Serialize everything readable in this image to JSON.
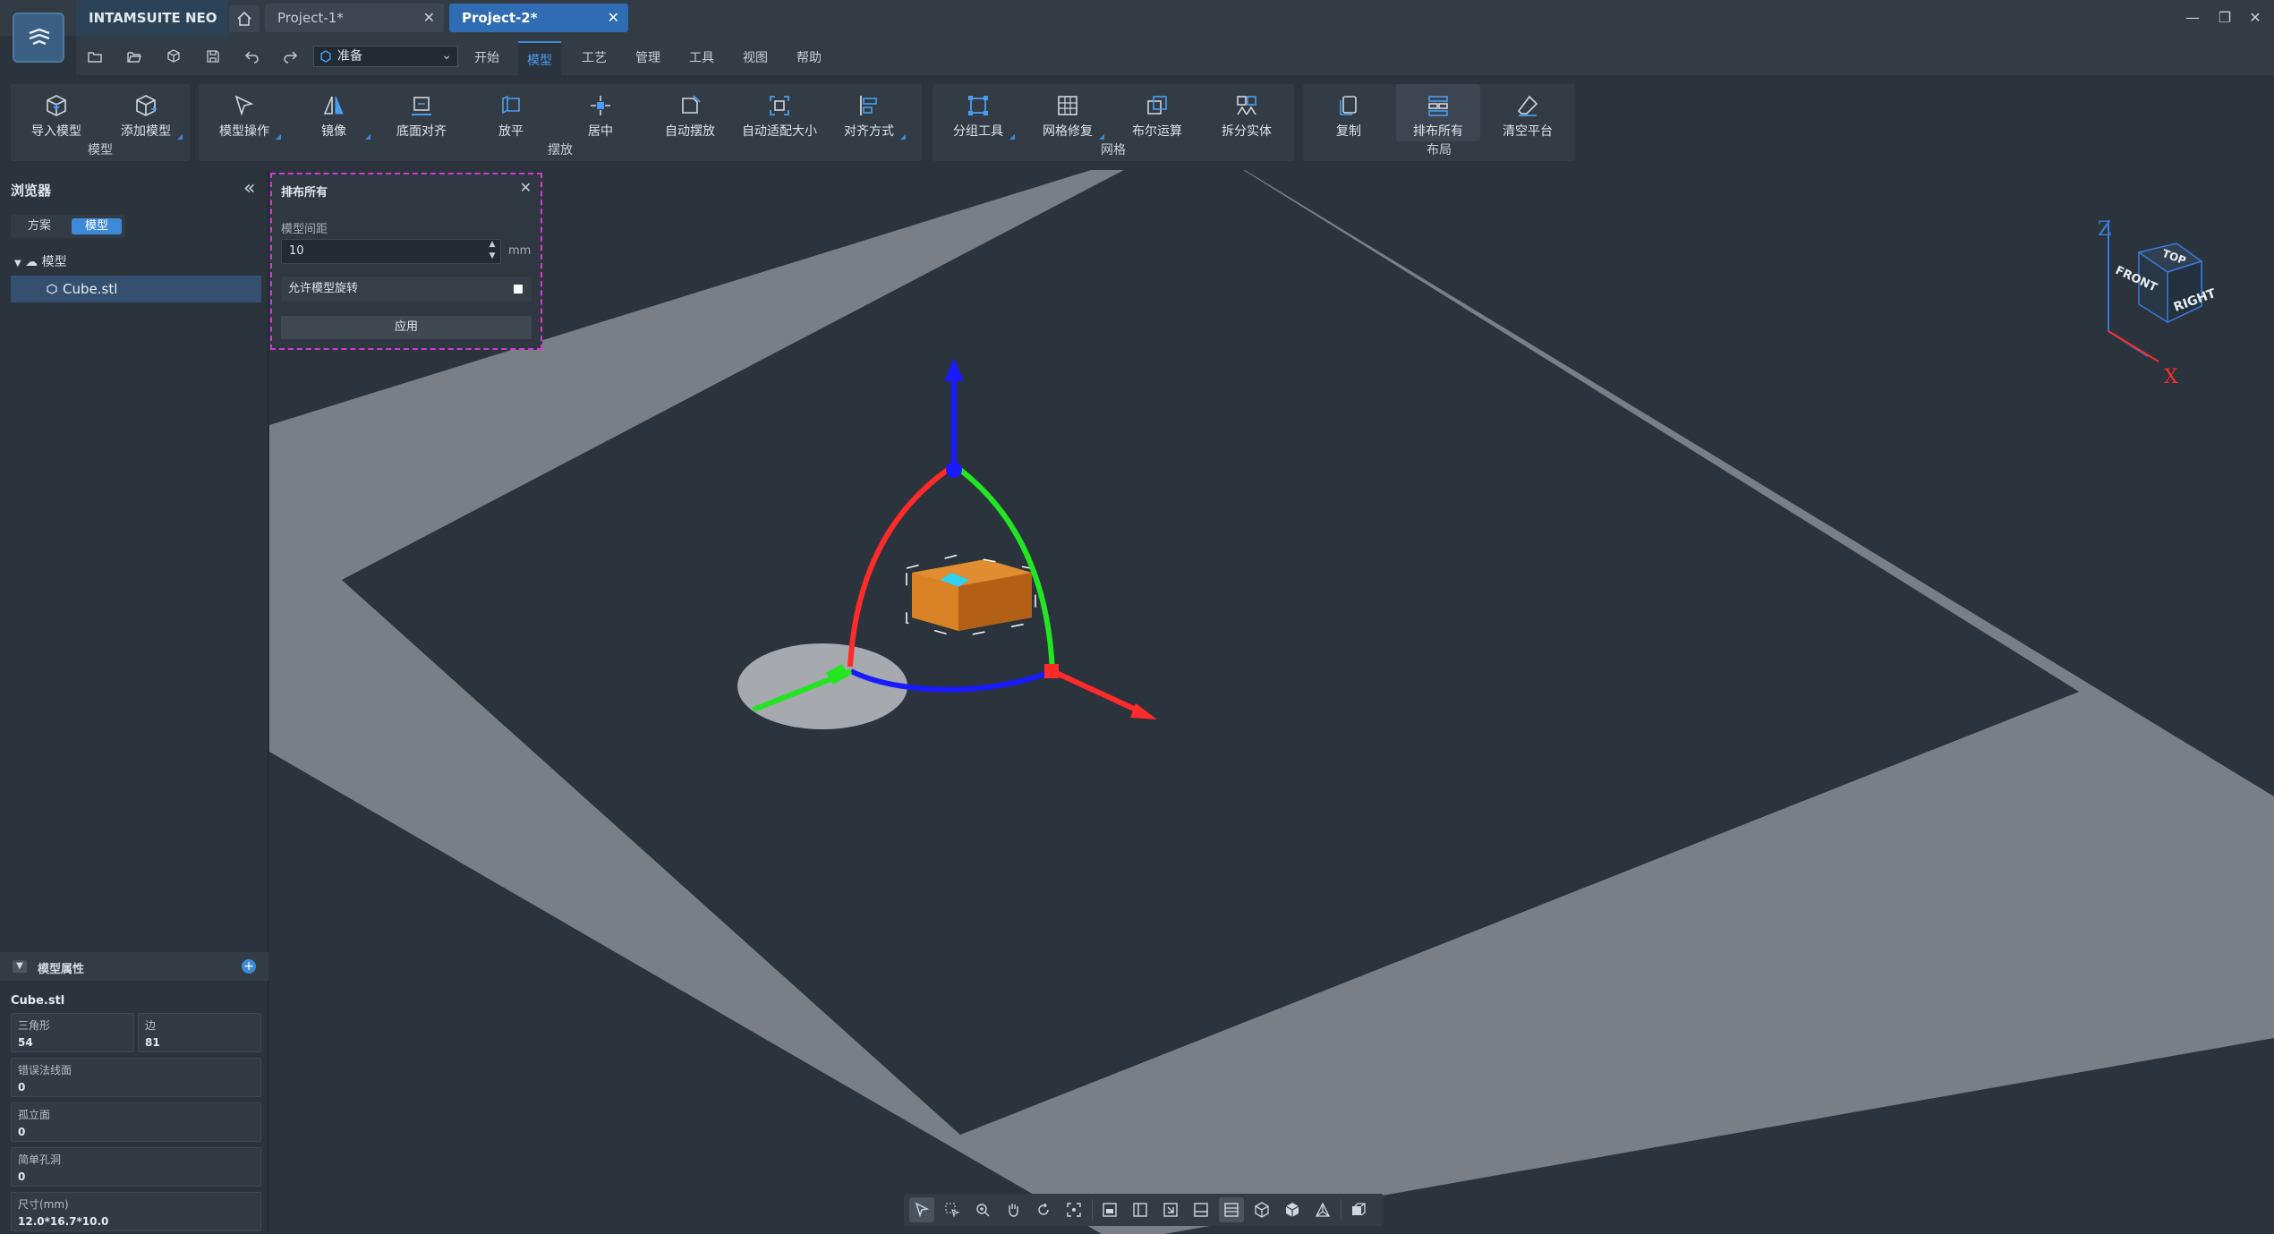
{
  "app": {
    "name": "INTAMSUITE NEO"
  },
  "tabs": [
    {
      "label": "Project-1*"
    },
    {
      "label": "Project-2*"
    }
  ],
  "toolbar": {
    "state": "准备"
  },
  "menu": [
    "开始",
    "模型",
    "工艺",
    "管理",
    "工具",
    "视图",
    "帮助"
  ],
  "ribbon": {
    "model": {
      "label": "模型",
      "buttons": [
        "导入模型",
        "添加模型"
      ]
    },
    "placement": {
      "label": "摆放",
      "buttons": [
        "模型操作",
        "镜像",
        "底面对齐",
        "放平",
        "居中",
        "自动摆放",
        "自动适配大小",
        "对齐方式"
      ]
    },
    "mesh": {
      "label": "网格",
      "buttons": [
        "分组工具",
        "网格修复",
        "布尔运算",
        "拆分实体"
      ]
    },
    "layout": {
      "label": "布局",
      "buttons": [
        "复制",
        "排布所有",
        "清空平台"
      ]
    }
  },
  "browser": {
    "title": "浏览器",
    "tabs": [
      "方案",
      "模型"
    ],
    "root": "模型",
    "item": "Cube.stl"
  },
  "properties": {
    "title": "模型属性",
    "name": "Cube.stl",
    "triangles_label": "三角形",
    "triangles": "54",
    "edges_label": "边",
    "edges": "81",
    "bad_normals_label": "错误法线面",
    "bad_normals": "0",
    "isolated_label": "孤立面",
    "isolated": "0",
    "holes_label": "简单孔洞",
    "holes": "0",
    "size_label": "尺寸(mm)",
    "size": "12.0*16.7*10.0"
  },
  "arrange": {
    "title": "排布所有",
    "spacing_label": "模型间距",
    "spacing_value": "10",
    "unit": "mm",
    "rotate_label": "允许模型旋转",
    "apply": "应用"
  },
  "viewcube": {
    "top": "TOP",
    "front": "FRONT",
    "right": "RIGHT",
    "z": "Z",
    "x": "X"
  },
  "colors": {
    "accent": "#3d8ad8",
    "highlight": "#d33bd4",
    "model": "#d98125",
    "axis_x": "#ff2a2a",
    "axis_y": "#22e622",
    "axis_z": "#1a1aff"
  }
}
